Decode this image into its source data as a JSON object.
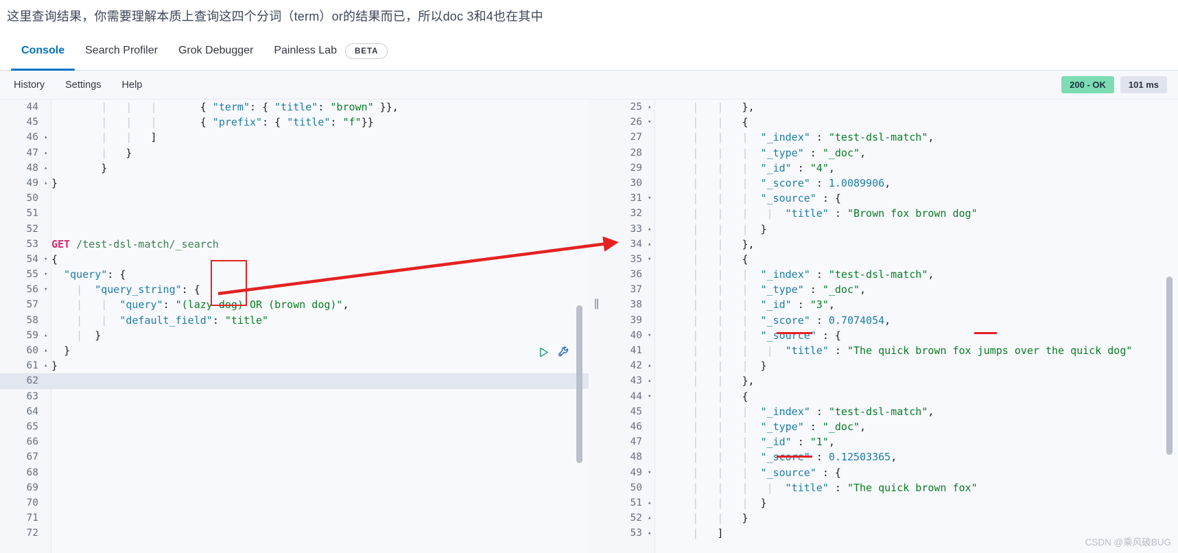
{
  "annotation_header": {
    "text": "这里查询结果，你需要理解本质上查询这四个分词（term）or的结果而已，所以doc 3和4也在其中"
  },
  "tabs": [
    {
      "label": "Console",
      "active": true
    },
    {
      "label": "Search Profiler",
      "active": false
    },
    {
      "label": "Grok Debugger",
      "active": false
    },
    {
      "label": "Painless Lab",
      "active": false
    }
  ],
  "beta_badge": "BETA",
  "toolbar": {
    "items": [
      "History",
      "Settings",
      "Help"
    ],
    "status_code": "200 - OK",
    "duration": "101 ms"
  },
  "icons": {
    "play": "play-icon",
    "wrench": "wrench-icon"
  },
  "request_editor": {
    "first_line_number": 44,
    "highlighted_line": 62,
    "lines": [
      {
        "n": 44,
        "fold": "",
        "text": "        |   |   |       { \"term\": { \"title\": \"brown\" }},"
      },
      {
        "n": 45,
        "fold": "",
        "text": "        |   |   |       { \"prefix\": { \"title\": \"f\"}}"
      },
      {
        "n": 46,
        "fold": "▴",
        "text": "        |   |   ]"
      },
      {
        "n": 47,
        "fold": "▴",
        "text": "        |   }"
      },
      {
        "n": 48,
        "fold": "▴",
        "text": "        }"
      },
      {
        "n": 49,
        "fold": "▴",
        "text": "}"
      },
      {
        "n": 50,
        "fold": "",
        "text": ""
      },
      {
        "n": 51,
        "fold": "",
        "text": ""
      },
      {
        "n": 52,
        "fold": "",
        "text": ""
      },
      {
        "n": 53,
        "fold": "",
        "text": "GET /test-dsl-match/_search"
      },
      {
        "n": 54,
        "fold": "▾",
        "text": "{"
      },
      {
        "n": 55,
        "fold": "▾",
        "text": "  \"query\": {"
      },
      {
        "n": 56,
        "fold": "▾",
        "text": "    |  \"query_string\": {"
      },
      {
        "n": 57,
        "fold": "",
        "text": "    |   |  \"query\": \"(lazy dog) OR (brown dog)\","
      },
      {
        "n": 58,
        "fold": "",
        "text": "    |   |  \"default_field\": \"title\""
      },
      {
        "n": 59,
        "fold": "▴",
        "text": "    |  }"
      },
      {
        "n": 60,
        "fold": "▴",
        "text": "  }"
      },
      {
        "n": 61,
        "fold": "▴",
        "text": "}"
      },
      {
        "n": 62,
        "fold": "",
        "text": ""
      },
      {
        "n": 63,
        "fold": "",
        "text": ""
      },
      {
        "n": 64,
        "fold": "",
        "text": ""
      },
      {
        "n": 65,
        "fold": "",
        "text": ""
      },
      {
        "n": 66,
        "fold": "",
        "text": ""
      },
      {
        "n": 67,
        "fold": "",
        "text": ""
      },
      {
        "n": 68,
        "fold": "",
        "text": ""
      },
      {
        "n": 69,
        "fold": "",
        "text": ""
      },
      {
        "n": 70,
        "fold": "",
        "text": ""
      },
      {
        "n": 71,
        "fold": "",
        "text": ""
      },
      {
        "n": 72,
        "fold": "",
        "text": ""
      }
    ],
    "request_method": "GET",
    "request_path": "/test-dsl-match/_search",
    "query_string_query": "(lazy dog) OR (brown dog)",
    "default_field": "title"
  },
  "response_viewer": {
    "first_line_number": 25,
    "lines": [
      {
        "n": 25,
        "fold": "▴",
        "text": "      |   |   },"
      },
      {
        "n": 26,
        "fold": "▾",
        "text": "      |   |   {"
      },
      {
        "n": 27,
        "fold": "",
        "text": "      |   |   |  \"_index\" : \"test-dsl-match\","
      },
      {
        "n": 28,
        "fold": "",
        "text": "      |   |   |  \"_type\" : \"_doc\","
      },
      {
        "n": 29,
        "fold": "",
        "text": "      |   |   |  \"_id\" : \"4\","
      },
      {
        "n": 30,
        "fold": "",
        "text": "      |   |   |  \"_score\" : 1.0089906,"
      },
      {
        "n": 31,
        "fold": "▾",
        "text": "      |   |   |  \"_source\" : {"
      },
      {
        "n": 32,
        "fold": "",
        "text": "      |   |   |   |  \"title\" : \"Brown fox brown dog\""
      },
      {
        "n": 33,
        "fold": "▴",
        "text": "      |   |   |  }"
      },
      {
        "n": 34,
        "fold": "▴",
        "text": "      |   |   },"
      },
      {
        "n": 35,
        "fold": "▾",
        "text": "      |   |   {"
      },
      {
        "n": 36,
        "fold": "",
        "text": "      |   |   |  \"_index\" : \"test-dsl-match\","
      },
      {
        "n": 37,
        "fold": "",
        "text": "      |   |   |  \"_type\" : \"_doc\","
      },
      {
        "n": 38,
        "fold": "",
        "text": "      |   |   |  \"_id\" : \"3\","
      },
      {
        "n": 39,
        "fold": "",
        "text": "      |   |   |  \"_score\" : 0.7074054,"
      },
      {
        "n": 40,
        "fold": "▾",
        "text": "      |   |   |  \"_source\" : {"
      },
      {
        "n": 41,
        "fold": "",
        "text": "      |   |   |   |  \"title\" : \"The quick brown fox jumps over the quick dog\""
      },
      {
        "n": 42,
        "fold": "▴",
        "text": "      |   |   |  }"
      },
      {
        "n": 43,
        "fold": "▴",
        "text": "      |   |   },"
      },
      {
        "n": 44,
        "fold": "▾",
        "text": "      |   |   {"
      },
      {
        "n": 45,
        "fold": "",
        "text": "      |   |   |  \"_index\" : \"test-dsl-match\","
      },
      {
        "n": 46,
        "fold": "",
        "text": "      |   |   |  \"_type\" : \"_doc\","
      },
      {
        "n": 47,
        "fold": "",
        "text": "      |   |   |  \"_id\" : \"1\","
      },
      {
        "n": 48,
        "fold": "",
        "text": "      |   |   |  \"_score\" : 0.12503365,"
      },
      {
        "n": 49,
        "fold": "▾",
        "text": "      |   |   |  \"_source\" : {"
      },
      {
        "n": 50,
        "fold": "",
        "text": "      |   |   |   |  \"title\" : \"The quick brown fox\""
      },
      {
        "n": 51,
        "fold": "▴",
        "text": "      |   |   |  }"
      },
      {
        "n": 52,
        "fold": "▴",
        "text": "      |   |   }"
      },
      {
        "n": 53,
        "fold": "▴",
        "text": "      |   ]"
      }
    ],
    "hits": [
      {
        "_index": "test-dsl-match",
        "_type": "_doc",
        "_id": "4",
        "_score": "1.0089906",
        "title": "Brown fox brown dog"
      },
      {
        "_index": "test-dsl-match",
        "_type": "_doc",
        "_id": "3",
        "_score": "0.7074054",
        "title": "The quick brown fox jumps over the quick dog"
      },
      {
        "_index": "test-dsl-match",
        "_type": "_doc",
        "_id": "1",
        "_score": "0.12503365",
        "title": "The quick brown fox"
      }
    ]
  },
  "watermark": "CSDN @乘风破BUG",
  "colors": {
    "accent": "#0071c2",
    "annotation_red": "#e32221",
    "status_ok_bg": "#7ddcb3",
    "duration_bg": "#dfe3ee",
    "string_green": "#077d22",
    "key_blue": "#1b7ca8",
    "method_pink": "#cf2a6d"
  }
}
